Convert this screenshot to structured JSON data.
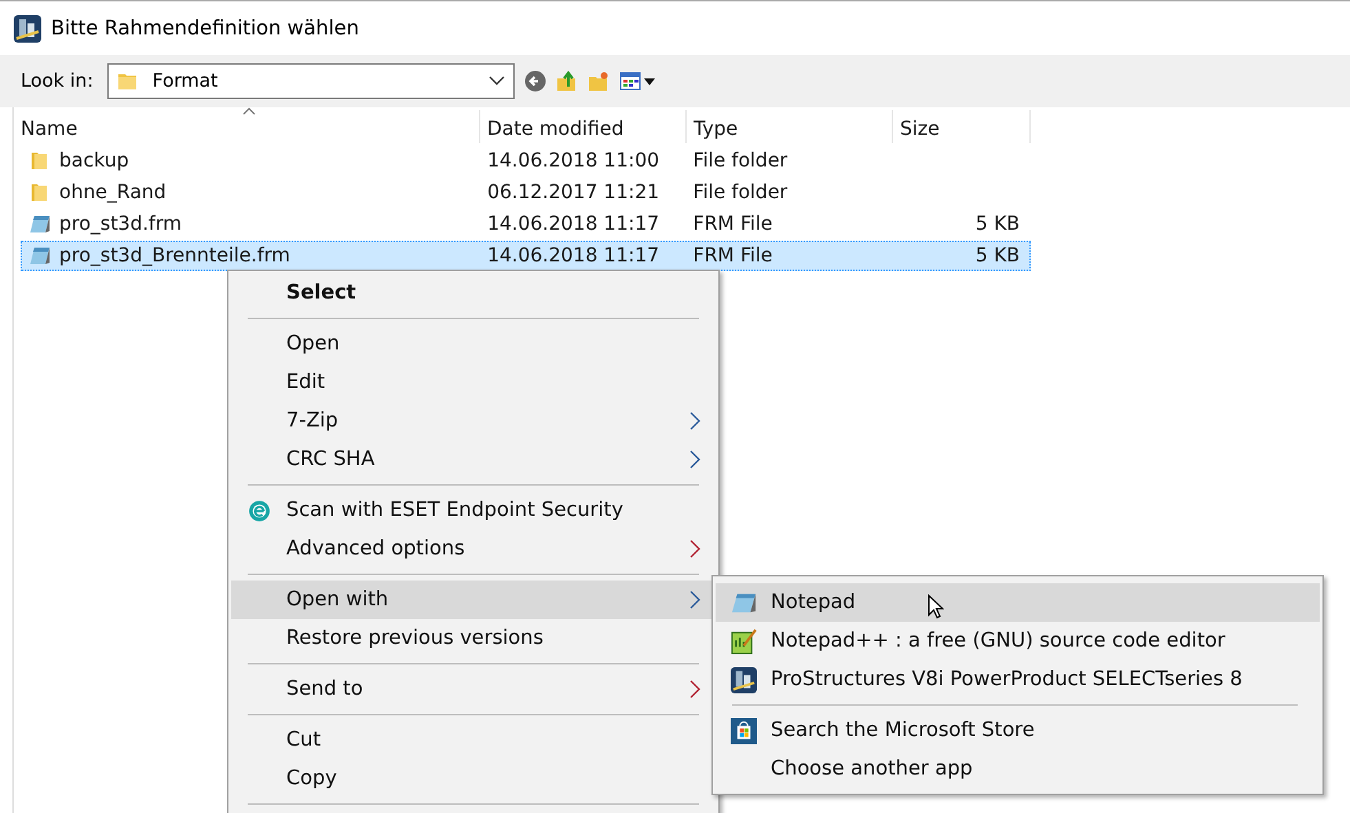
{
  "window": {
    "title": "Bitte Rahmendefinition wählen"
  },
  "look_in": {
    "label": "Look in:",
    "value": "Format"
  },
  "table": {
    "columns": [
      "Name",
      "Date modified",
      "Type",
      "Size"
    ],
    "rows": [
      {
        "kind": "folder",
        "name": "backup",
        "date": "14.06.2018 11:00",
        "type": "File folder",
        "size": "",
        "selected": false
      },
      {
        "kind": "folder",
        "name": "ohne_Rand",
        "date": "06.12.2017 11:21",
        "type": "File folder",
        "size": "",
        "selected": false
      },
      {
        "kind": "file",
        "name": "pro_st3d.frm",
        "date": "14.06.2018 11:17",
        "type": "FRM File",
        "size": "5 KB",
        "selected": false
      },
      {
        "kind": "file",
        "name": "pro_st3d_Brennteile.frm",
        "date": "14.06.2018 11:17",
        "type": "FRM File",
        "size": "5 KB",
        "selected": true
      }
    ]
  },
  "context_menu": {
    "items": [
      {
        "kind": "item",
        "label": "Select",
        "default": true,
        "submenu": false,
        "selected": false
      },
      {
        "kind": "separator"
      },
      {
        "kind": "item",
        "label": "Open",
        "default": false,
        "submenu": false,
        "selected": false
      },
      {
        "kind": "item",
        "label": "Edit",
        "default": false,
        "submenu": false,
        "selected": false
      },
      {
        "kind": "item",
        "label": "7-Zip",
        "default": false,
        "submenu": true,
        "selected": false
      },
      {
        "kind": "item",
        "label": "CRC SHA",
        "default": false,
        "submenu": true,
        "selected": false
      },
      {
        "kind": "separator"
      },
      {
        "kind": "item",
        "label": "Scan with ESET Endpoint Security",
        "default": false,
        "submenu": false,
        "selected": false
      },
      {
        "kind": "item",
        "label": "Advanced options",
        "default": false,
        "submenu": true,
        "selected": false
      },
      {
        "kind": "separator"
      },
      {
        "kind": "item",
        "label": "Open with",
        "default": false,
        "submenu": true,
        "selected": true
      },
      {
        "kind": "item",
        "label": "Restore previous versions",
        "default": false,
        "submenu": false,
        "selected": false
      },
      {
        "kind": "separator"
      },
      {
        "kind": "item",
        "label": "Send to",
        "default": false,
        "submenu": true,
        "selected": false
      },
      {
        "kind": "separator"
      },
      {
        "kind": "item",
        "label": "Cut",
        "default": false,
        "submenu": false,
        "selected": false
      },
      {
        "kind": "item",
        "label": "Copy",
        "default": false,
        "submenu": false,
        "selected": false
      },
      {
        "kind": "separator"
      }
    ]
  },
  "open_with_menu": {
    "items": [
      {
        "kind": "item",
        "label": "Notepad",
        "selected": true
      },
      {
        "kind": "item",
        "label": "Notepad++ : a free (GNU) source code editor",
        "selected": false
      },
      {
        "kind": "item",
        "label": "ProStructures V8i PowerProduct SELECTseries 8",
        "selected": false
      },
      {
        "kind": "separator"
      },
      {
        "kind": "item",
        "label": "Search the Microsoft Store",
        "selected": false
      },
      {
        "kind": "item",
        "label": "Choose another app",
        "selected": false
      }
    ]
  }
}
